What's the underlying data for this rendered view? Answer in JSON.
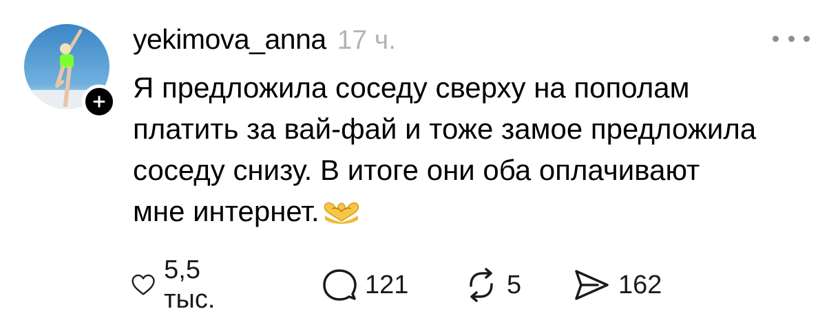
{
  "post": {
    "author": "yekimova_anna",
    "time": "17 ч.",
    "text_lines": [
      "Я предложила соседу сверху на пополам",
      "платить за вай-фай и тоже замое предложила",
      "соседу снизу. В итоге они оба оплачивают",
      "мне интернет."
    ],
    "emoji_icon": "heart-hands-icon"
  },
  "actions": {
    "likes": "5,5 тыс.",
    "comments": "121",
    "reposts": "5",
    "shares": "162"
  },
  "colors": {
    "text": "#000000",
    "secondary": "#b3b3b3",
    "icon": "#1a1a1a",
    "badge": "#000000"
  }
}
